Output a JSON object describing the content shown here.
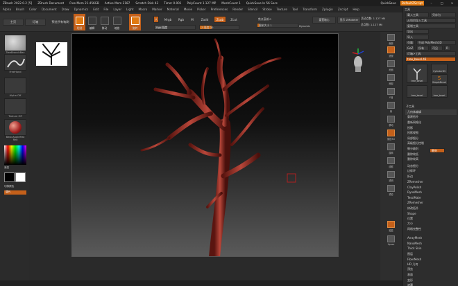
{
  "titlebar": {
    "app": "ZBrush 2022.0.2 [5]",
    "doc": "ZBrush Document",
    "free_mem": "Free Mem 21.456GB",
    "active_mem": "Active Mem 2187",
    "scratch": "Scratch Disk 43",
    "timer": "Timer 0.001",
    "polycount": "PolyCount 1.127 MP",
    "meshcount": "MeshCount 1",
    "quicksave": "QuickSave In 56 Secs",
    "quicksave_btn": "QuickSave",
    "script_btn": "DefaultZScript",
    "accent": "#e07a12"
  },
  "menubar": {
    "items": [
      "Alpha",
      "Brush",
      "Color",
      "Document",
      "Draw",
      "Dynamics",
      "Edit",
      "File",
      "Layer",
      "Light",
      "Macro",
      "Marker",
      "Material",
      "Movie",
      "Picker",
      "Preferences",
      "Render",
      "Stencil",
      "Stroke",
      "Texture",
      "Tool",
      "Transform",
      "Zplugin",
      "Zscript",
      "Help"
    ],
    "right": [
      "Menus",
      "DefaultZScript"
    ]
  },
  "toolbar": {
    "home": "主页",
    "lightbox": "灯箱",
    "preview": "预览所有笔刷",
    "draw": "绘制",
    "edit": "编辑",
    "move": "移动",
    "scale": "缩放",
    "rotate": "旋转",
    "mrgb": "Mrgb",
    "rgb": "Rgb",
    "m": "M",
    "zadd": "Zadd",
    "zsub": "Zsub",
    "zcut": "Zcut",
    "rgb_intensity": "Rgb 强度",
    "z_intensity": "Z 强度 30",
    "focal": "焦点衰减 0",
    "draw_size": "绘制大小 1",
    "dynamic": "Dynamic",
    "active_points": "活动点数: 1.127 Mil",
    "total_points": "总点数: 1.127 Mil",
    "spotlight": "重置轴心",
    "zmodeler": "显示 ZModeler"
  },
  "left": {
    "brush_label": "TreeBranchBev",
    "stroke_label": "FreeHand",
    "alpha_label": "Alpha Off",
    "texture_label": "Texture Off",
    "material_label": "BasicAppleMat Red",
    "gradient_label": "渐变",
    "switch_label": "切换颜色",
    "swatch_label": "替代"
  },
  "rightstrip": {
    "items": [
      "缩放",
      "透视",
      "地面",
      "局部",
      "Y轴",
      "帧",
      "移动",
      "缩放3D",
      "旋转",
      "线框",
      "透明",
      "重影",
      "独显",
      "Xpose"
    ]
  },
  "toolpanel": {
    "header": "工具",
    "load": "载入工具",
    "save": "另存为",
    "copy": "从项目导入工具",
    "clone": "复制工具",
    "export": "导出",
    "import": "导入",
    "clone2": "克隆",
    "make_polymesh": "生成 PolyMesh3D",
    "goz": "GoZ",
    "all": "所有",
    "visible": "可见",
    "r": "R",
    "lightbox_tools": "灯箱>工具",
    "current_tool": "tree_bevel.46",
    "tools": [
      {
        "name": "tree_bevel"
      },
      {
        "name": "Cylinder3D"
      },
      {
        "name": "SimpleBrush"
      },
      {
        "name": "tree_bevel"
      },
      {
        "name": "tree_bevel"
      }
    ],
    "subtool_header": "子工具",
    "subtool_items": [
      "几何体编辑",
      "重建拓扑",
      "重新网格化",
      "投影",
      "投影视图",
      "局部细分",
      "高级细分控制",
      "细分级别",
      "删除较低",
      "删除较高"
    ],
    "orange_btn": "细分",
    "list": [
      "动态细分",
      "边缘环",
      "折边",
      "ZRemesher",
      "ClayPolish",
      "DynaMesh",
      "TessiMate",
      "ZRemesher",
      "修改拓扑",
      "Shape",
      "位置",
      "大小",
      "网格完整性"
    ],
    "list2": [
      "ArrayMesh",
      "NanoMesh",
      "Thick Skin",
      "图层",
      "FiberMesh",
      "HD 几何",
      "预览",
      "表面",
      "变形",
      "遮罩"
    ]
  }
}
